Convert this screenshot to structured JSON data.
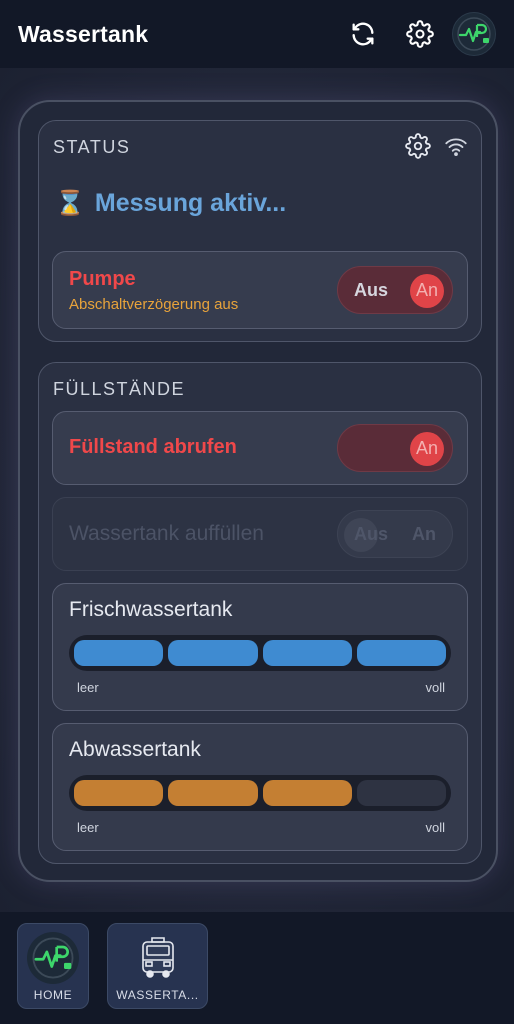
{
  "appbar": {
    "title": "Wassertank",
    "icons": [
      "refresh-icon",
      "gear-icon",
      "logo-avatar"
    ]
  },
  "status": {
    "title": "STATUS",
    "icons": [
      "gear-icon",
      "wifi-icon"
    ],
    "measurement_icon": "⌛",
    "measurement_text": "Messung aktiv...",
    "pump": {
      "label": "Pumpe",
      "sublabel": "Abschaltverzögerung aus",
      "toggle_off": "Aus",
      "toggle_on": "An",
      "state": "An"
    }
  },
  "levels": {
    "title": "FÜLLSTÄNDE",
    "fetch": {
      "label": "Füllstand abrufen",
      "toggle_on": "An",
      "state": "An"
    },
    "refill": {
      "label": "Wassertank auffüllen",
      "toggle_off": "Aus",
      "toggle_on": "An",
      "disabled": true
    },
    "fresh": {
      "title": "Frischwassertank",
      "level_segments": 4,
      "total_segments": 4,
      "min_label": "leer",
      "max_label": "voll",
      "color": "#3f8bd1"
    },
    "waste": {
      "title": "Abwassertank",
      "level_segments": 3,
      "total_segments": 4,
      "min_label": "leer",
      "max_label": "voll",
      "color": "#c47f33"
    }
  },
  "bottom_nav": {
    "items": [
      {
        "label": "HOME",
        "icon": "logo-icon"
      },
      {
        "label": "WASSERTA...",
        "icon": "camper-icon"
      }
    ]
  },
  "colors": {
    "accent_red": "#f0484a",
    "warning_orange": "#e8a33b",
    "measure_blue": "#6aa5db"
  }
}
